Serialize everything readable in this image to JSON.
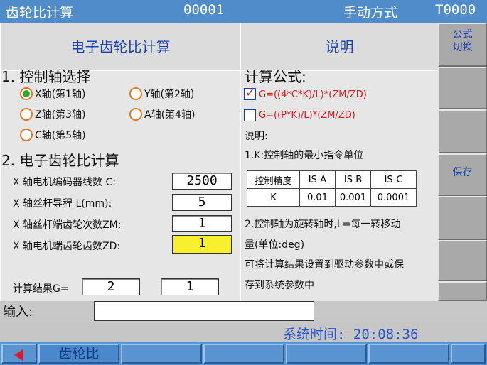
{
  "topbar": {
    "title": "齿轮比计算",
    "program": "00001",
    "mode": "手动方式",
    "tool": "T0000"
  },
  "left_panel": {
    "header": "电子齿轮比计算",
    "axis_section_title": "1. 控制轴选择",
    "axes": [
      {
        "label": "X轴(第1轴)",
        "selected": true
      },
      {
        "label": "Y轴(第2轴)",
        "selected": false
      },
      {
        "label": "Z轴(第3轴)",
        "selected": false
      },
      {
        "label": "A轴(第4轴)",
        "selected": false
      },
      {
        "label": "C轴(第5轴)",
        "selected": false
      }
    ],
    "calc_section_title": "2. 电子齿轮比计算",
    "fields": [
      {
        "label": "X 轴电机编码器线数 C:",
        "value": "2500"
      },
      {
        "label": "X 轴丝杆导程  L(mm):",
        "value": "5"
      },
      {
        "label": "X 轴丝杆端齿轮次数ZM:",
        "value": "1"
      },
      {
        "label": "X 轴电机端齿轮齿数ZD:",
        "value": "1"
      }
    ],
    "result_label": "计算结果G=",
    "result_num": "2",
    "result_den": "1"
  },
  "right_panel": {
    "header": "说明",
    "formula_title": "计算公式:",
    "formula1": "G=((4*C*K)/L)*(ZM/ZD)",
    "formula2": "G=((P*K)/L)*(ZM/ZD)",
    "note_title": "说明:",
    "note1": "1.K:控制轴的最小指令单位",
    "table_header": [
      "控制精度",
      "IS-A",
      "IS-B",
      "IS-C"
    ],
    "table_row": [
      "K",
      "0.01",
      "0.001",
      "0.0001"
    ],
    "note2_line1": "2.控制轴为旋转轴时,L=每一转移动",
    "note2_line2": "量(单位:deg)",
    "note3_line1": "可将计算结果设置到驱动参数中或保",
    "note3_line2": "存到系统参数中"
  },
  "softkeys_right": {
    "formula_switch_l1": "公式",
    "formula_switch_l2": "切换",
    "save": "保存"
  },
  "input": {
    "label": "输入:",
    "value": ""
  },
  "status": {
    "system_time": "系统时间: 20:08:36"
  },
  "bottom": {
    "gear_ratio": "齿轮比"
  },
  "colors": {
    "accent_blue": "#4f8cc9",
    "highlight_yellow": "#f8ef2e",
    "formula_red": "#d81818",
    "radio_green": "#2aa82a"
  }
}
